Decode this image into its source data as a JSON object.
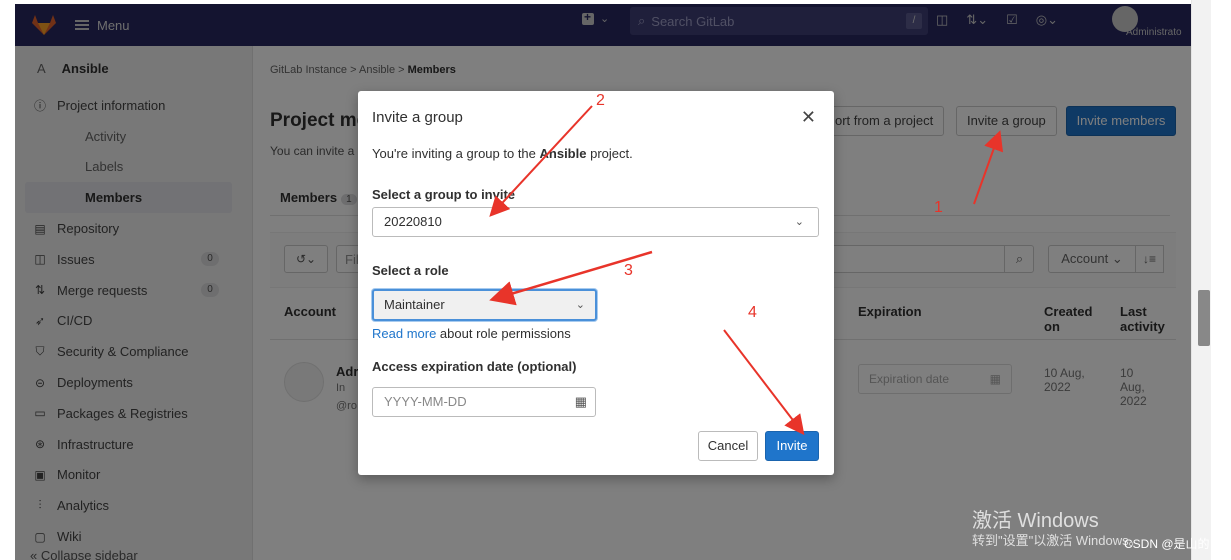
{
  "topbar": {
    "menu_label": "Menu",
    "search_placeholder": "Search GitLab",
    "search_key": "/",
    "admin_label": "Administrato"
  },
  "sidebar": {
    "project_letter": "A",
    "project_name": "Ansible",
    "items": [
      {
        "label": "Project information",
        "icon": "info-icon"
      },
      {
        "label": "Activity"
      },
      {
        "label": "Labels"
      },
      {
        "label": "Members"
      },
      {
        "label": "Repository",
        "icon": "doc-icon"
      },
      {
        "label": "Issues",
        "icon": "issues-icon",
        "count": "0"
      },
      {
        "label": "Merge requests",
        "icon": "merge-icon",
        "count": "0"
      },
      {
        "label": "CI/CD",
        "icon": "rocket-icon"
      },
      {
        "label": "Security & Compliance",
        "icon": "shield-icon"
      },
      {
        "label": "Deployments",
        "icon": "deploy-icon"
      },
      {
        "label": "Packages & Registries",
        "icon": "package-icon"
      },
      {
        "label": "Infrastructure",
        "icon": "cloud-icon"
      },
      {
        "label": "Monitor",
        "icon": "monitor-icon"
      },
      {
        "label": "Analytics",
        "icon": "chart-icon"
      },
      {
        "label": "Wiki",
        "icon": "book-icon"
      }
    ],
    "collapse_label": "« Collapse sidebar"
  },
  "main": {
    "breadcrumb": [
      "GitLab Instance",
      "Ansible",
      "Members"
    ],
    "title": "Project me",
    "desc": "You can invite a",
    "import_btn": "ort from a project",
    "invite_group_btn": "Invite a group",
    "invite_members_btn": "Invite members",
    "tab_members": "Members",
    "tab_count": "1",
    "filter_partial": "Fil",
    "sort_label": "Account",
    "col_account": "Account",
    "col_expiration": "Expiration",
    "col_created": "Created on",
    "col_last_activity": "Last activity",
    "row_name": "Adr",
    "row_badge": "In",
    "row_handle": "@ro",
    "row_exp_placeholder": "Expiration date",
    "row_created": "10 Aug, 2022",
    "row_last_activity": "10 Aug, 2022"
  },
  "modal": {
    "title": "Invite a group",
    "subtitle_prefix": "You're inviting a group to the ",
    "project_name": "Ansible",
    "subtitle_suffix": " project.",
    "group_label": "Select a group to invite",
    "group_value": "20220810",
    "role_label": "Select a role",
    "role_value": "Maintainer",
    "read_more": "Read more",
    "read_more_suffix": " about role permissions",
    "exp_label": "Access expiration date (optional)",
    "exp_placeholder": "YYYY-MM-DD",
    "cancel": "Cancel",
    "invite": "Invite"
  },
  "annotations": {
    "numbers": [
      "1",
      "2",
      "3",
      "4"
    ],
    "color": "#e8342a"
  },
  "watermark": {
    "line1": "激活 Windows",
    "line2": "转到\"设置\"以激活 Windows。",
    "csdn": "CSDN @是山的"
  },
  "colors": {
    "topbar": "#292961",
    "primary": "#1f75cb"
  }
}
